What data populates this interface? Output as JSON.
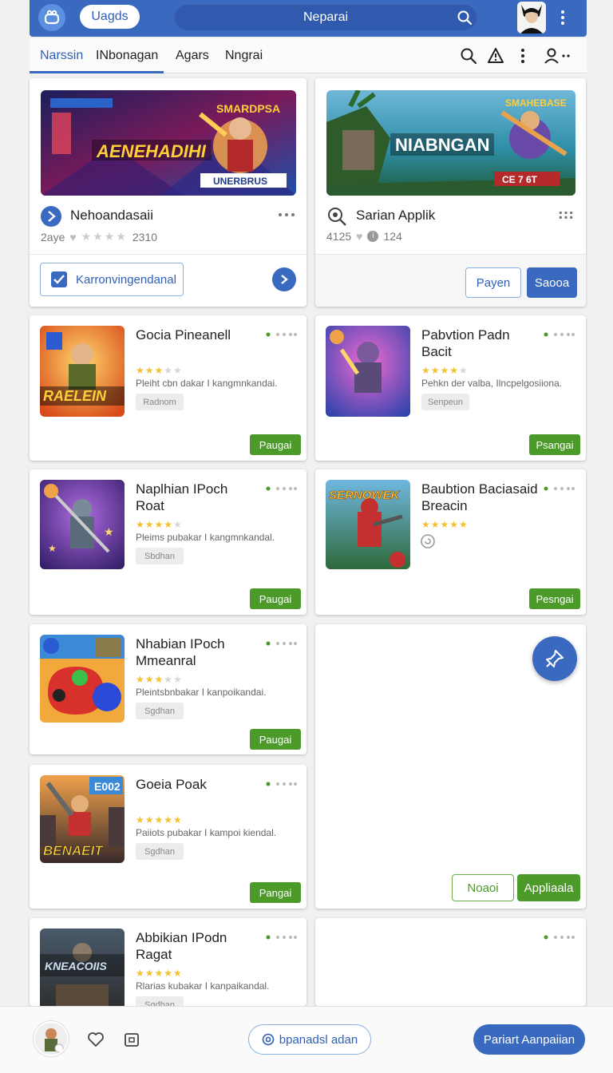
{
  "colors": {
    "primary": "#3a69c0",
    "green": "#4c9a2a",
    "star": "#f2c12e"
  },
  "header": {
    "app_pill": "Uagds",
    "search_text": "Neparai"
  },
  "tabs": [
    {
      "label": "Narssin",
      "active": true
    },
    {
      "label": "INbonagan"
    },
    {
      "label": "Agars"
    },
    {
      "label": "Nngrai"
    }
  ],
  "featured": [
    {
      "banner_title": "AENEHADIHI",
      "banner_top": "SMARDPSA",
      "banner_bottom": "UNERBRUS",
      "name": "Nehoandasaii",
      "meta_left": "2aye",
      "meta_right": "2310",
      "footer_button": "Karronvingendanal"
    },
    {
      "banner_title": "NIABNGAN",
      "banner_top": "SMAHEBASE",
      "banner_bottom": "CE 7 6T",
      "name": "Sarian Applik",
      "meta_left": "4125",
      "meta_right": "124",
      "btn_outline": "Payen",
      "btn_solid": "Saooa"
    }
  ],
  "apps": [
    {
      "name": "Gocia Pineanell",
      "thumb_text": "RAELEIN",
      "desc": "Pleiht cbn dakar I kangmnkandai.",
      "tag": "Radnom",
      "action": "Paugai",
      "rating": 3
    },
    {
      "name": "Pabvtion Padn Bacit",
      "thumb_text": "",
      "desc": "Pehkn der valba, Ilncpelgosiiona.",
      "tag": "Senpeun",
      "action": "Psangai",
      "rating": 4
    },
    {
      "name": "Naplhian IPoch Roat",
      "thumb_text": "",
      "desc": "Pleims pubakar I kangmnkandal.",
      "tag": "Sbdhan",
      "action": "Paugai",
      "rating": 4
    },
    {
      "name": "Baubtion Baciasaid Breacin",
      "thumb_text": "SERNOWEK",
      "desc": "",
      "tag": "",
      "action": "Pesngai",
      "rating": 5
    },
    {
      "name": "Nhabian IPoch Mmeanral",
      "thumb_text": "",
      "desc": "Pleintsbnbakar I kanpoikandai.",
      "tag": "Sgdhan",
      "action": "Paugai",
      "rating": 3
    },
    {
      "name": "Goeia Poak",
      "thumb_text": "BENAEIT",
      "badge": "E002",
      "desc": "Paiiots pubakar I kampoi kiendal.",
      "tag": "Sgdhan",
      "action": "Pangai",
      "rating": 5
    },
    {
      "name": "Abbikian IPodn Ragat",
      "thumb_text": "KNEACOIIS",
      "desc": "Rlarias kubakar I kanpaikandal.",
      "tag": "Sgdhan",
      "rating": 5
    }
  ],
  "panel_buttons": {
    "outline": "Noaoi",
    "solid": "Appliaala"
  },
  "bottom": {
    "pill": "bpanadsl adan",
    "primary": "Pariart Aanpaiian"
  }
}
